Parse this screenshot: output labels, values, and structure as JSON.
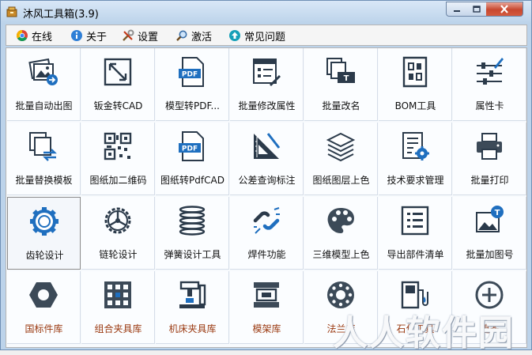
{
  "window": {
    "title": "沐风工具箱(3.9)"
  },
  "menu": [
    {
      "label": "在线",
      "icon": "chrome-icon"
    },
    {
      "label": "关于",
      "icon": "info-icon"
    },
    {
      "label": "设置",
      "icon": "tools-icon"
    },
    {
      "label": "激活",
      "icon": "magnifier-icon"
    },
    {
      "label": "常见问题",
      "icon": "help-arrow-icon"
    }
  ],
  "tools": [
    {
      "label": "批量自动出图",
      "icon": "image-export-icon"
    },
    {
      "label": "钣金转CAD",
      "icon": "arrows-diagonal-icon"
    },
    {
      "label": "模型转PDF...",
      "icon": "pdf-icon"
    },
    {
      "label": "批量修改属性",
      "icon": "property-edit-icon"
    },
    {
      "label": "批量改名",
      "icon": "rename-icon"
    },
    {
      "label": "BOM工具",
      "icon": "bom-icon"
    },
    {
      "label": "属性卡",
      "icon": "sliders-icon"
    },
    {
      "label": "批量替换模板",
      "icon": "template-replace-icon"
    },
    {
      "label": "图纸加二维码",
      "icon": "qrcode-icon"
    },
    {
      "label": "图纸转PdfCAD",
      "icon": "pdf-icon"
    },
    {
      "label": "公差查询标注",
      "icon": "set-square-icon"
    },
    {
      "label": "图纸图层上色",
      "icon": "layers-icon"
    },
    {
      "label": "技术要求管理",
      "icon": "document-gear-icon"
    },
    {
      "label": "批量打印",
      "icon": "printer-icon"
    },
    {
      "label": "齿轮设计",
      "icon": "gear-icon"
    },
    {
      "label": "链轮设计",
      "icon": "sprocket-icon"
    },
    {
      "label": "弹簧设计工具",
      "icon": "spring-icon"
    },
    {
      "label": "焊件功能",
      "icon": "broken-link-icon"
    },
    {
      "label": "三维模型上色",
      "icon": "palette-icon"
    },
    {
      "label": "导出部件清单",
      "icon": "list-icon"
    },
    {
      "label": "批量加图号",
      "icon": "image-badge-icon"
    },
    {
      "label": "国标件库",
      "icon": "hex-nut-icon"
    },
    {
      "label": "组合夹具库",
      "icon": "fixture-grid-icon"
    },
    {
      "label": "机床夹具库",
      "icon": "machine-fixture-icon"
    },
    {
      "label": "模架库",
      "icon": "mold-base-icon"
    },
    {
      "label": "法兰库",
      "icon": "flange-icon"
    },
    {
      "label": "石化工具",
      "icon": "fuel-pump-icon"
    },
    {
      "label": "更多",
      "icon": "plus-circle-icon"
    }
  ],
  "watermark": "人人软件园",
  "colors": {
    "icon_dark": "#2b3a4a",
    "icon_blue": "#1f6fbf",
    "label_brown": "#9b3a12"
  }
}
